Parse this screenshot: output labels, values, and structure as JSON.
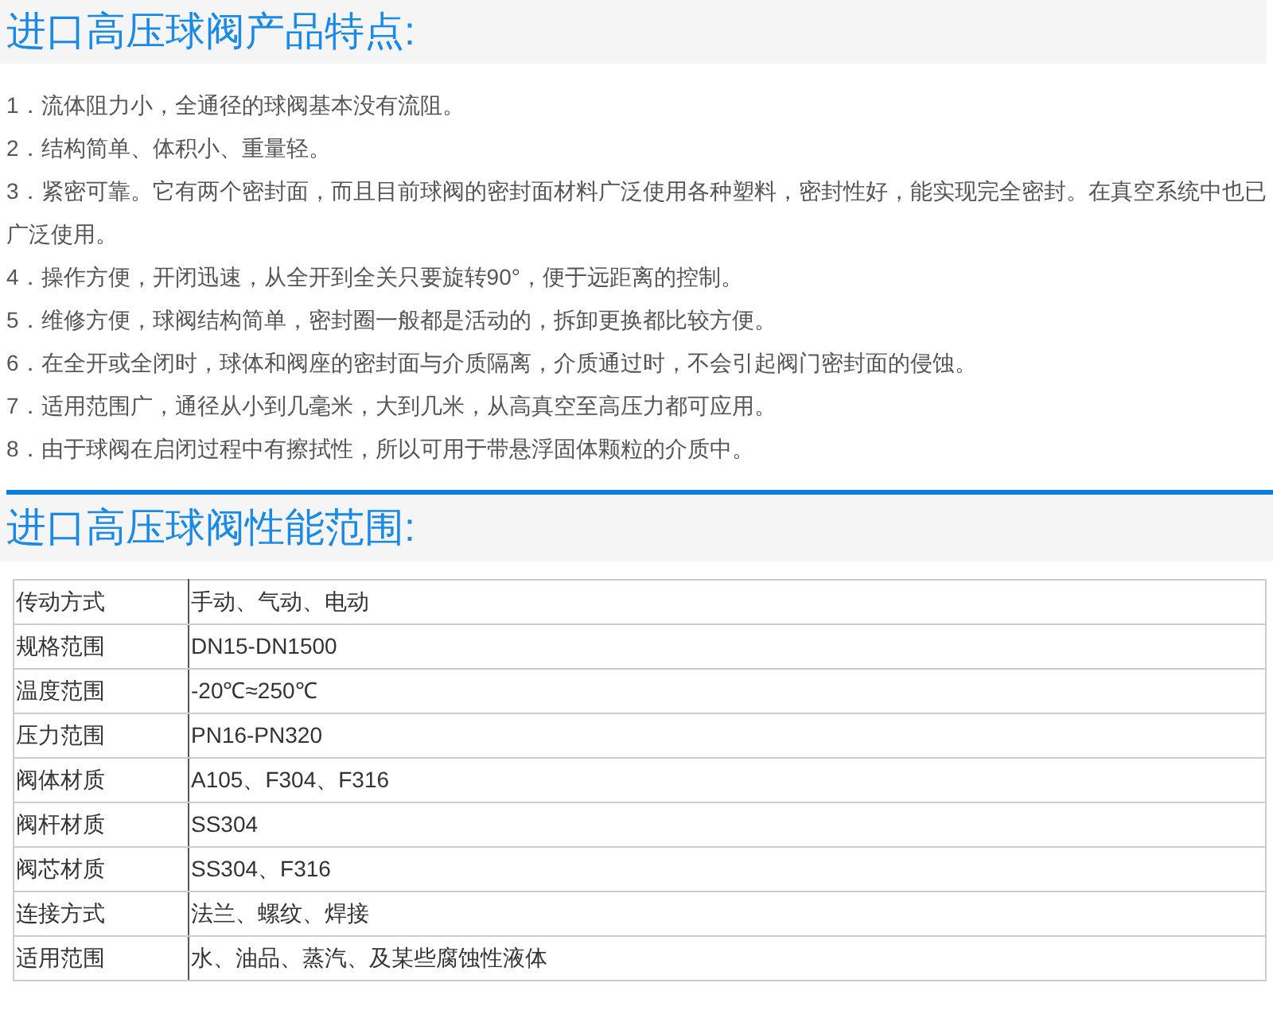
{
  "features": {
    "title": "进口高压球阀产品特点:",
    "items": [
      "1．流体阻力小，全通径的球阀基本没有流阻。",
      "2．结构简单、体积小、重量轻。",
      "3．紧密可靠。它有两个密封面，而且目前球阀的密封面材料广泛使用各种塑料，密封性好，能实现完全密封。在真空系统中也已广泛使用。",
      "4．操作方便，开闭迅速，从全开到全关只要旋转90°，便于远距离的控制。",
      "5．维修方便，球阀结构简单，密封圈一般都是活动的，拆卸更换都比较方便。",
      "6．在全开或全闭时，球体和阀座的密封面与介质隔离，介质通过时，不会引起阀门密封面的侵蚀。",
      "7．适用范围广，通径从小到几毫米，大到几米，从高真空至高压力都可应用。",
      "8．由于球阀在启闭过程中有擦拭性，所以可用于带悬浮固体颗粒的介质中。"
    ]
  },
  "performance": {
    "title": "进口高压球阀性能范围:",
    "rows": [
      {
        "label": "传动方式",
        "value": "手动、气动、电动"
      },
      {
        "label": "规格范围",
        "value": "DN15-DN1500"
      },
      {
        "label": "温度范围",
        "value": "-20℃≈250℃"
      },
      {
        "label": "压力范围",
        "value": "PN16-PN320"
      },
      {
        "label": "阀体材质",
        "value": "A105、F304、F316"
      },
      {
        "label": "阀杆材质",
        "value": "SS304"
      },
      {
        "label": "阀芯材质",
        "value": "SS304、F316"
      },
      {
        "label": "连接方式",
        "value": "法兰、螺纹、焊接"
      },
      {
        "label": "适用范围",
        "value": "水、油品、蒸汽、及某些腐蚀性液体"
      }
    ]
  }
}
